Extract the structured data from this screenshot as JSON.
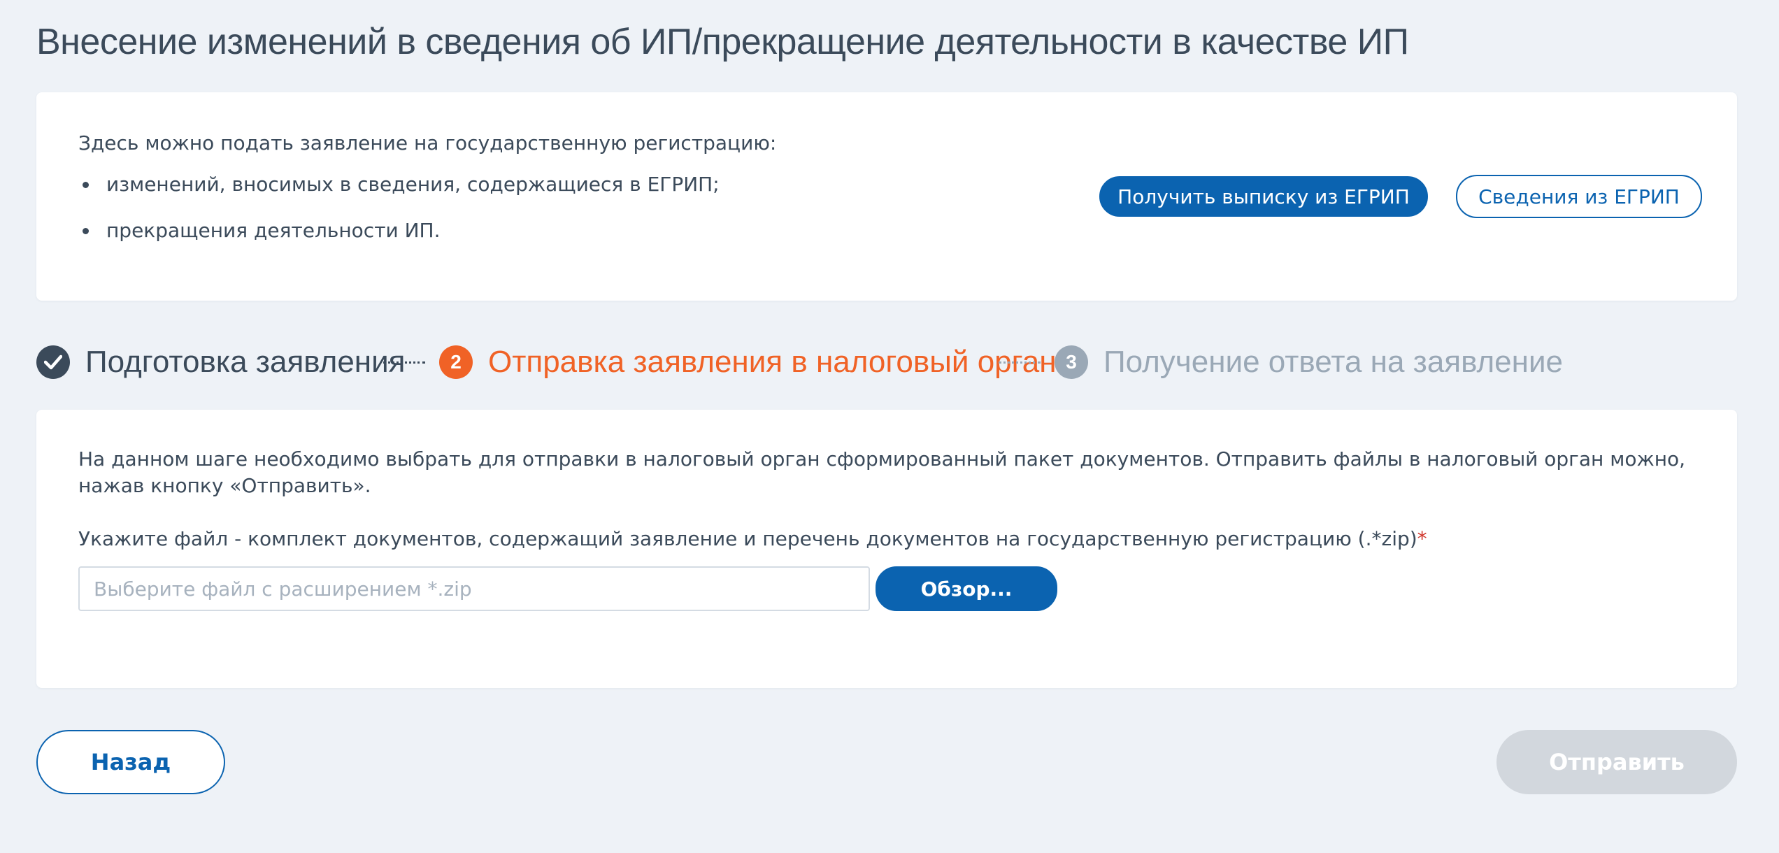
{
  "page": {
    "title": "Внесение изменений в сведения об ИП/прекращение деятельности в качестве ИП"
  },
  "info": {
    "intro": "Здесь можно подать заявление на государственную регистрацию:",
    "items": [
      "изменений, вносимых в сведения, содержащиеся в ЕГРИП;",
      "прекращения деятельности ИП."
    ],
    "extract_button": "Получить выписку из ЕГРИП",
    "info_button": "Сведения из ЕГРИП"
  },
  "steps": [
    {
      "number": "✓",
      "label": "Подготовка заявления",
      "status": "done",
      "icon": "check-icon"
    },
    {
      "number": "2",
      "label": "Отправка заявления в налоговый орган",
      "status": "active"
    },
    {
      "number": "3",
      "label": "Получение ответа на заявление",
      "status": "pending"
    }
  ],
  "upload": {
    "description": "На данном шаге необходимо выбрать для отправки в налоговый орган сформированный пакет документов. Отправить файлы в налоговый орган можно, нажав кнопку «Отправить».",
    "file_label": "Укажите файл - комплект документов, содержащий заявление и перечень документов на государственную регистрацию (.*zip)",
    "required_mark": "*",
    "file_value": "",
    "file_placeholder": "Выберите файл с расширением *.zip",
    "browse_button": "Обзор..."
  },
  "footer": {
    "back_button": "Назад",
    "submit_button": "Отправить"
  },
  "colors": {
    "primary": "#0b63b0",
    "active_step": "#f06226",
    "done_step": "#3b4a5a",
    "pending_step": "#9aa8b6",
    "required": "#d0352b",
    "disabled_button": "#d2d7dd",
    "background": "#eef2f7"
  }
}
